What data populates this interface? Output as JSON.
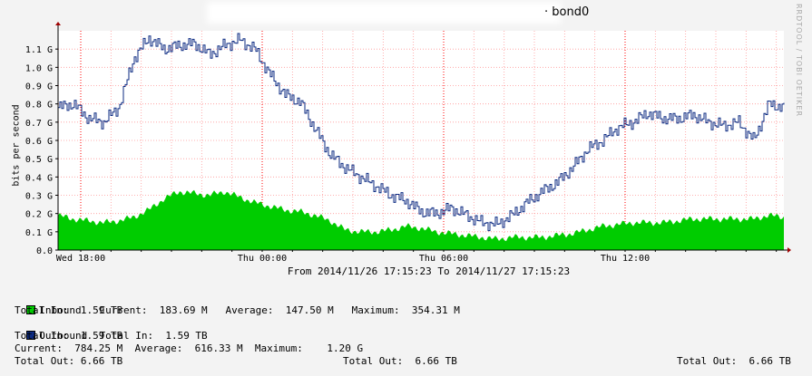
{
  "title": "· bond0",
  "side_text": "RRDTOOL / TOBI OETIKER",
  "caption": "From 2014/11/26 17:15:23 To 2014/11/27 17:15:23",
  "legend": {
    "line1": "Inbound   Current:  183.69 M   Average:  147.50 M   Maximum:  354.31 M",
    "line2": "Total In:  1.59 TB",
    "line3": "Outbound  Total In:  1.59 TB",
    "line4": "Total In:  1.59 TB",
    "line5": "Current:  784.25 M  Average:  616.33 M  Maximum:    1.20 G",
    "line6a": "Total Out: 6.66 TB",
    "line6b": "Total Out:  6.66 TB",
    "line6c": "Total Out:  6.66 TB"
  },
  "colors": {
    "inbound": "#00cc00",
    "outbound": "#0b2a82",
    "grid": "#ff9999",
    "axis": "#000000"
  },
  "chart_data": {
    "type": "area",
    "title": "bond0",
    "ylabel": "bits per second",
    "xlabel": "From 2014/11/26 17:15:23 To 2014/11/27 17:15:23",
    "ylim": [
      0,
      1.2
    ],
    "xlim": [
      0,
      24
    ],
    "y_ticks": [
      {
        "v": 0.0,
        "label": "0.0"
      },
      {
        "v": 0.1,
        "label": "0.1 G"
      },
      {
        "v": 0.2,
        "label": "0.2 G"
      },
      {
        "v": 0.3,
        "label": "0.3 G"
      },
      {
        "v": 0.4,
        "label": "0.4 G"
      },
      {
        "v": 0.5,
        "label": "0.5 G"
      },
      {
        "v": 0.6,
        "label": "0.6 G"
      },
      {
        "v": 0.7,
        "label": "0.7 G"
      },
      {
        "v": 0.8,
        "label": "0.8 G"
      },
      {
        "v": 0.9,
        "label": "0.9 G"
      },
      {
        "v": 1.0,
        "label": "1.0 G"
      },
      {
        "v": 1.1,
        "label": "1.1 G"
      }
    ],
    "x_ticks": [
      {
        "v": 0.75,
        "label": "Wed 18:00"
      },
      {
        "v": 6.75,
        "label": "Thu 00:00"
      },
      {
        "v": 12.75,
        "label": "Thu 06:00"
      },
      {
        "v": 18.75,
        "label": "Thu 12:00"
      }
    ],
    "x": [
      0,
      0.5,
      1,
      1.5,
      2,
      2.5,
      3,
      3.5,
      4,
      4.5,
      5,
      5.5,
      6,
      6.5,
      7,
      7.5,
      8,
      8.5,
      9,
      9.5,
      10,
      10.5,
      11,
      11.5,
      12,
      12.5,
      13,
      13.5,
      14,
      14.5,
      15,
      15.5,
      16,
      16.5,
      17,
      17.5,
      18,
      18.5,
      19,
      19.5,
      20,
      20.5,
      21,
      21.5,
      22,
      22.5,
      23,
      23.5,
      24
    ],
    "series": [
      {
        "name": "Inbound",
        "values": [
          0.19,
          0.17,
          0.16,
          0.15,
          0.16,
          0.18,
          0.22,
          0.28,
          0.32,
          0.31,
          0.3,
          0.32,
          0.29,
          0.26,
          0.24,
          0.22,
          0.21,
          0.19,
          0.16,
          0.11,
          0.1,
          0.1,
          0.11,
          0.13,
          0.12,
          0.1,
          0.09,
          0.08,
          0.07,
          0.06,
          0.07,
          0.07,
          0.07,
          0.08,
          0.09,
          0.11,
          0.13,
          0.14,
          0.15,
          0.15,
          0.15,
          0.16,
          0.17,
          0.17,
          0.17,
          0.17,
          0.17,
          0.19,
          0.18
        ]
      },
      {
        "name": "Outbound",
        "values": [
          0.78,
          0.8,
          0.72,
          0.7,
          0.78,
          1.05,
          1.16,
          1.1,
          1.12,
          1.13,
          1.07,
          1.12,
          1.15,
          1.1,
          0.96,
          0.85,
          0.81,
          0.66,
          0.52,
          0.45,
          0.4,
          0.35,
          0.3,
          0.27,
          0.21,
          0.2,
          0.23,
          0.19,
          0.15,
          0.14,
          0.19,
          0.26,
          0.32,
          0.37,
          0.45,
          0.55,
          0.6,
          0.67,
          0.7,
          0.75,
          0.72,
          0.72,
          0.74,
          0.7,
          0.68,
          0.7,
          0.6,
          0.8,
          0.78
        ]
      }
    ]
  }
}
